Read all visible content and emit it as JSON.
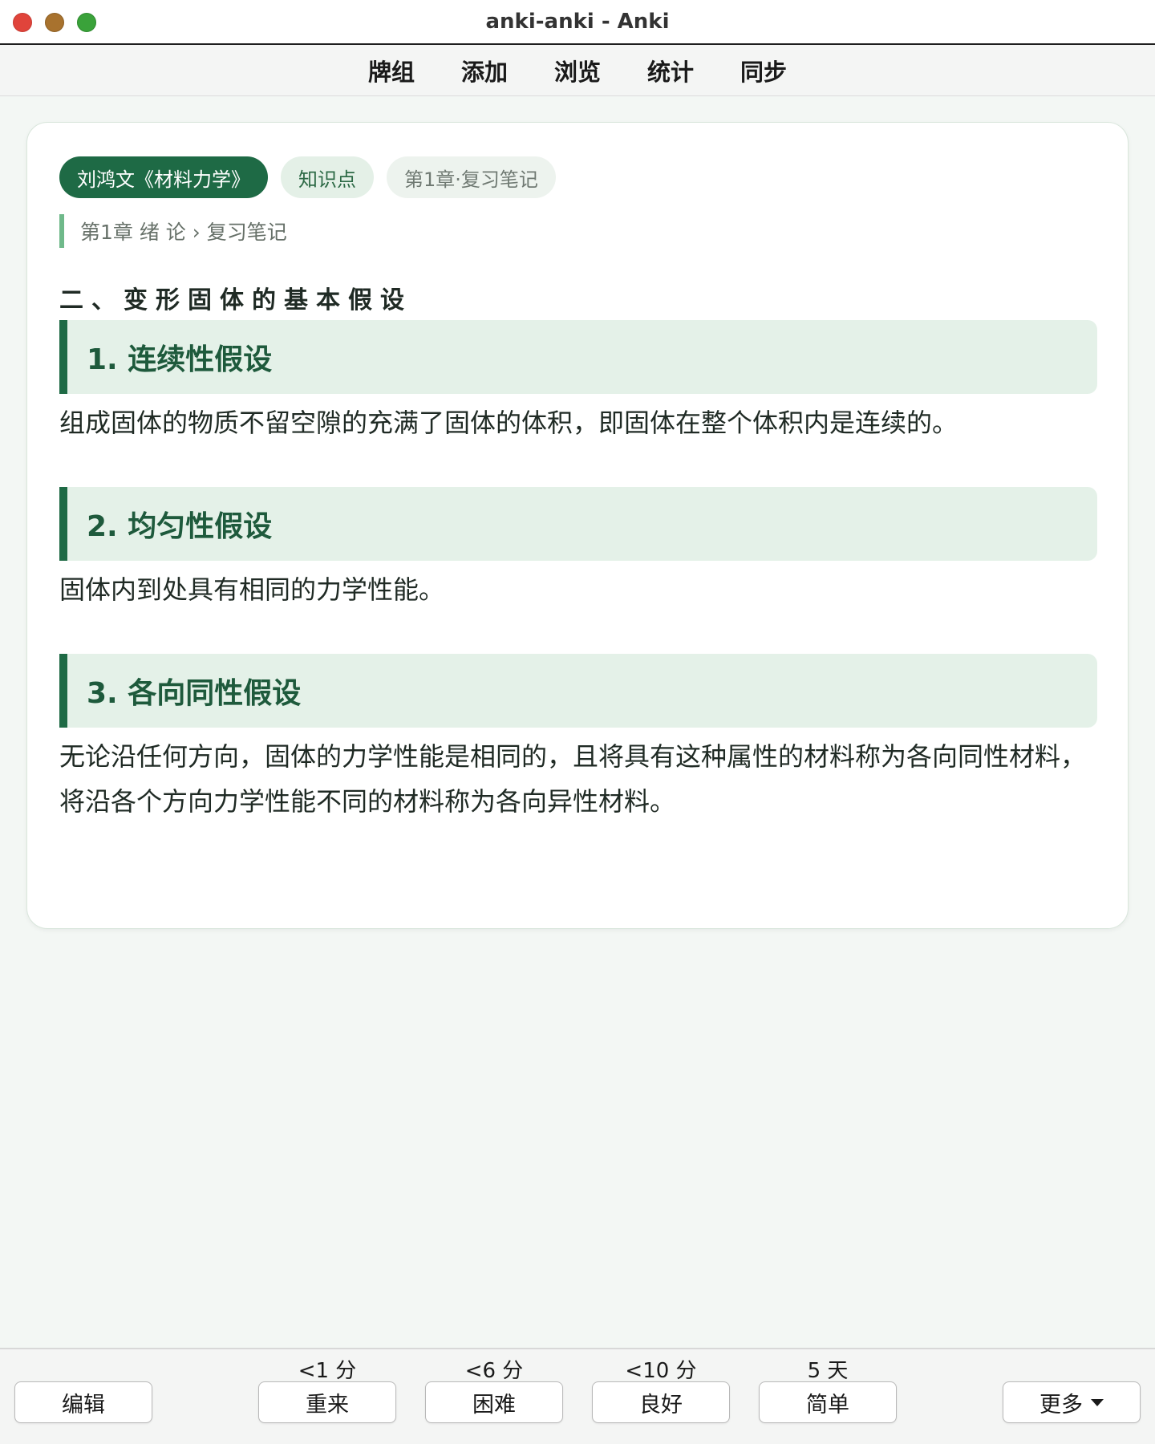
{
  "window": {
    "title": "anki-anki - Anki",
    "controls": [
      "close",
      "minimize",
      "zoom"
    ]
  },
  "toolbar": {
    "items": [
      "牌组",
      "添加",
      "浏览",
      "统计",
      "同步"
    ]
  },
  "card": {
    "tags": [
      "刘鸿文《材料力学》",
      "知识点",
      "第1章·复习笔记"
    ],
    "breadcrumb": "第1章 绪 论 › 复习笔记",
    "section_title": "二、变形固体的基本假设",
    "items": [
      {
        "heading": "1. 连续性假设",
        "body": "组成固体的物质不留空隙的充满了固体的体积，即固体在整个体积内是连续的。"
      },
      {
        "heading": "2. 均匀性假设",
        "body": "固体内到处具有相同的力学性能。"
      },
      {
        "heading": "3. 各向同性假设",
        "body": "无论沿任何方向，固体的力学性能是相同的，且将具有这种属性的材料称为各向同性材料，将沿各个方向力学性能不同的材料称为各向异性材料。"
      }
    ]
  },
  "bottom": {
    "edit_label": "编辑",
    "more_label": "更多",
    "answers": [
      {
        "label": "重来",
        "interval": "<1 分"
      },
      {
        "label": "困难",
        "interval": "<6 分"
      },
      {
        "label": "良好",
        "interval": "<10 分"
      },
      {
        "label": "简单",
        "interval": "5 天"
      }
    ]
  },
  "colors": {
    "accent": "#1e6a45",
    "heading_bg": "#e4f1e8",
    "page_bg": "#f3f7f4"
  }
}
